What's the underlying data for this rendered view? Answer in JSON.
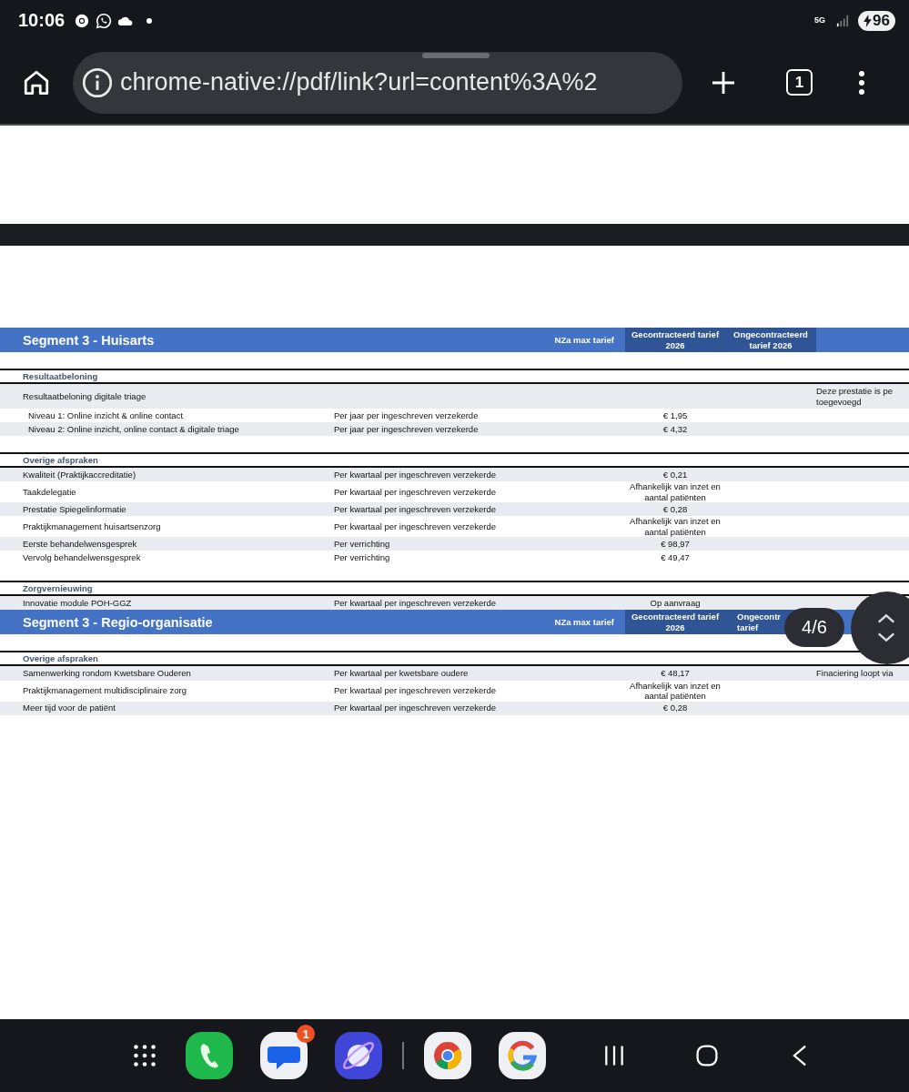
{
  "status_bar": {
    "time": "10:06",
    "network": "5G",
    "battery": "96"
  },
  "toolbar": {
    "url": "chrome-native://pdf/link?url=content%3A%2",
    "tab_count": "1"
  },
  "sections": [
    {
      "title": "Segment 3 - Huisarts",
      "columns": [
        {
          "lines": [
            "NZa max tarief"
          ],
          "kind": "plain"
        },
        {
          "lines": [
            "Gecontracteerd tarief",
            "2026"
          ],
          "kind": "dark"
        },
        {
          "lines": [
            "Ongecontracteerd",
            "tarief 2026"
          ],
          "kind": "dark"
        }
      ],
      "groups": [
        {
          "title": "Resultaatbeloning",
          "rows": [
            {
              "kind": "item",
              "label": "Resultaatbeloning digitale triage",
              "unit": "",
              "contracted": [],
              "note": [
                "Deze prestatie is pe",
                "toegevoegd"
              ]
            },
            {
              "kind": "sub",
              "label": "Niveau 1: Online inzicht & online contact",
              "unit": "Per jaar per ingeschreven verzekerde",
              "contracted": [
                "€ 1,95"
              ],
              "note": []
            },
            {
              "kind": "sub",
              "label": "Niveau 2: Online inzicht, online contact & digitale triage",
              "unit": "Per jaar per ingeschreven verzekerde",
              "contracted": [
                "€ 4,32"
              ],
              "note": []
            }
          ]
        },
        {
          "title": "Overige afspraken",
          "rows": [
            {
              "kind": "item",
              "label": "Kwaliteit (Praktijkaccreditatie)",
              "unit": "Per kwartaal per ingeschreven verzekerde",
              "contracted": [
                "€ 0,21"
              ],
              "note": []
            },
            {
              "kind": "item",
              "label": "Taakdelegatie",
              "unit": "Per kwartaal per ingeschreven verzekerde",
              "contracted": [
                "Afhankelijk van inzet en",
                "aantal patiënten"
              ],
              "note": []
            },
            {
              "kind": "item",
              "label": "Prestatie Spiegelinformatie",
              "unit": "Per kwartaal per ingeschreven verzekerde",
              "contracted": [
                "€ 0,28"
              ],
              "note": []
            },
            {
              "kind": "item",
              "label": "Praktijkmanagement huisartsenzorg",
              "unit": "Per kwartaal per ingeschreven verzekerde",
              "contracted": [
                "Afhankelijk van inzet en",
                "aantal patiënten"
              ],
              "note": []
            },
            {
              "kind": "item",
              "label": "Eerste behandelwensgesprek",
              "unit": "Per verrichting",
              "contracted": [
                "€ 98,97"
              ],
              "note": []
            },
            {
              "kind": "item",
              "label": "Vervolg behandelwensgesprek",
              "unit": "Per verrichting",
              "contracted": [
                "€ 49,47"
              ],
              "note": []
            }
          ]
        },
        {
          "title": "Zorgvernieuwing",
          "rows": [
            {
              "kind": "item",
              "label": "Innovatie module POH-GGZ",
              "unit": "Per kwartaal per ingeschreven verzekerde",
              "contracted": [
                "Op aanvraag"
              ],
              "note": []
            }
          ]
        }
      ]
    },
    {
      "title": "Segment 3 - Regio-organisatie",
      "columns": [
        {
          "lines": [
            "NZa max tarief"
          ],
          "kind": "plain"
        },
        {
          "lines": [
            "Gecontracteerd tarief",
            "2026"
          ],
          "kind": "dark"
        },
        {
          "lines": [
            "Ongecontr",
            "tarief"
          ],
          "kind": "clipped"
        }
      ],
      "groups": [
        {
          "title": "Overige afspraken",
          "rows": [
            {
              "kind": "item",
              "label": "Samenwerking rondom Kwetsbare Ouderen",
              "unit": "Per kwartaal per kwetsbare oudere",
              "contracted": [
                "€ 48,17"
              ],
              "note": [
                "Finaciering loopt via"
              ]
            },
            {
              "kind": "item",
              "label": "Praktijkmanagement multidisciplinaire zorg",
              "unit": "Per kwartaal per ingeschreven verzekerde",
              "contracted": [
                "Afhankelijk van inzet en",
                "aantal patiënten"
              ],
              "note": []
            },
            {
              "kind": "item",
              "label": "Meer tijd voor de patiënt",
              "unit": "Per kwartaal per ingeschreven verzekerde",
              "contracted": [
                "€ 0,28"
              ],
              "note": []
            }
          ]
        }
      ]
    }
  ],
  "viewer": {
    "page": "4/6"
  },
  "nav": {
    "badge": "1"
  }
}
